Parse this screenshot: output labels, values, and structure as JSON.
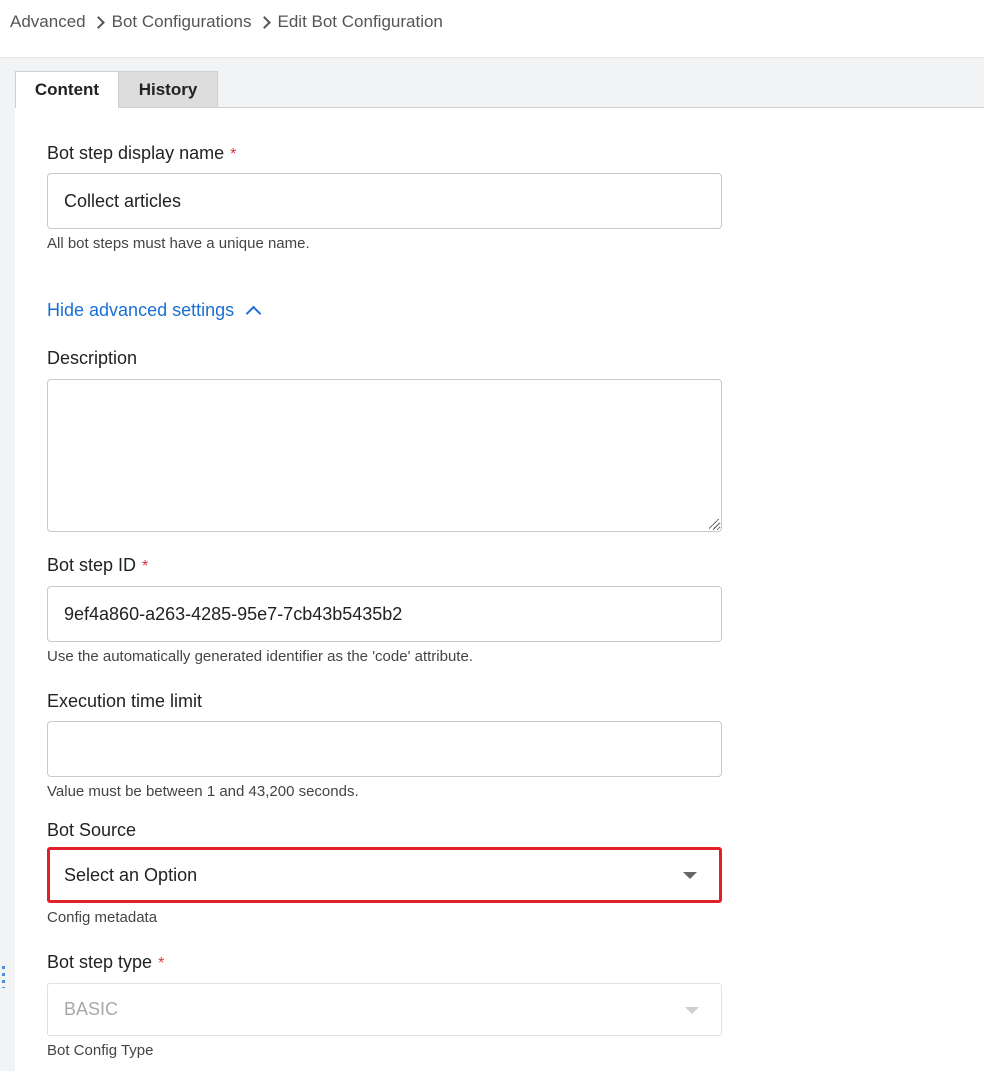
{
  "breadcrumb": {
    "items": [
      "Advanced",
      "Bot Configurations",
      "Edit Bot Configuration"
    ]
  },
  "tabs": [
    {
      "label": "Content",
      "active": true
    },
    {
      "label": "History",
      "active": false
    }
  ],
  "form": {
    "display_name": {
      "label": "Bot step display name",
      "required": "*",
      "value": "Collect articles",
      "help": "All bot steps must have a unique name."
    },
    "advanced_toggle": {
      "label": "Hide advanced settings",
      "icon": "chevron-up-icon"
    },
    "description": {
      "label": "Description",
      "value": ""
    },
    "step_id": {
      "label": "Bot step ID",
      "required": "*",
      "value": "9ef4a860-a263-4285-95e7-7cb43b5435b2",
      "help": "Use the automatically generated identifier as the 'code' attribute."
    },
    "time_limit": {
      "label": "Execution time limit",
      "value": "",
      "help": "Value must be between 1 and 43,200 seconds."
    },
    "bot_source": {
      "label": "Bot Source",
      "selected": "Select an Option",
      "help": "Config metadata",
      "highlight_color": "#e0202a"
    },
    "step_type": {
      "label": "Bot step type",
      "required": "*",
      "selected": "BASIC",
      "help": "Bot Config Type",
      "disabled": true
    }
  },
  "colors": {
    "link": "#1a6fd6",
    "required": "#d9363e"
  }
}
